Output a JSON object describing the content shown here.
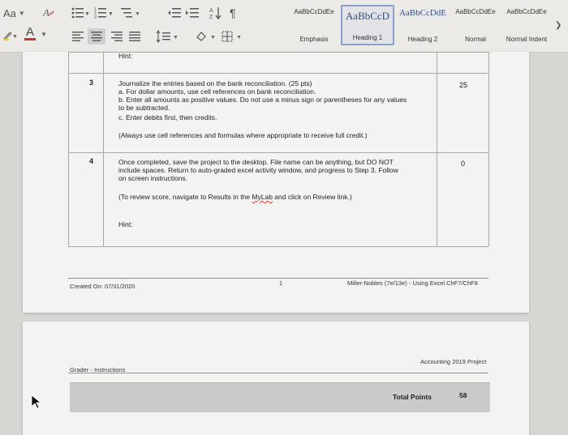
{
  "ribbon": {
    "font_button": "Aa",
    "styles": [
      {
        "sample": "AaBbCcDdEe",
        "name": "Emphasis"
      },
      {
        "sample": "AaBbCcD",
        "name": "Heading 1"
      },
      {
        "sample": "AaBbCcDdE",
        "name": "Heading 2"
      },
      {
        "sample": "AaBbCcDdEe",
        "name": "Normal"
      },
      {
        "sample": "AaBbCcDdEe",
        "name": "Normal Indent"
      }
    ],
    "selected_style": "Heading 1"
  },
  "document": {
    "top_hint": "Hint:",
    "rows": [
      {
        "num": "3",
        "points": "25",
        "lines": [
          "Journalize the entries based on the bank reconciliation. (25 pts)",
          "a. For dollar amounts, use cell references on bank reconciliation.",
          "b. Enter all amounts as positive values. Do not use a minus sign or parentheses for any values",
          "to be subtracted.",
          "c. Enter debits first, then credits."
        ],
        "note": "(Always use cell references and formulas where appropriate to receive full credit.)"
      },
      {
        "num": "4",
        "points": "0",
        "lines": [
          "Once completed, save the project to the desktop. File name can be anything, but DO NOT",
          "include spaces. Return to auto-graded excel activity window, and progress to Step 3. Follow",
          "on screen instructions."
        ],
        "note_before": "(To review score, navigate to Results in the ",
        "note_link": "MyLab",
        "note_after": " and click on Review link.)",
        "hint": "Hint:"
      }
    ],
    "footer": {
      "created": "Created On: 07/31/2020",
      "page_num": "1",
      "right": "Miller-Nobles (7e/13e) - Using Excel ChF7/ChF8"
    },
    "page2": {
      "header_left": "Grader - Instructions",
      "header_right": "Accounting 2019 Project",
      "total_label": "Total Points",
      "total_value": "58"
    }
  }
}
